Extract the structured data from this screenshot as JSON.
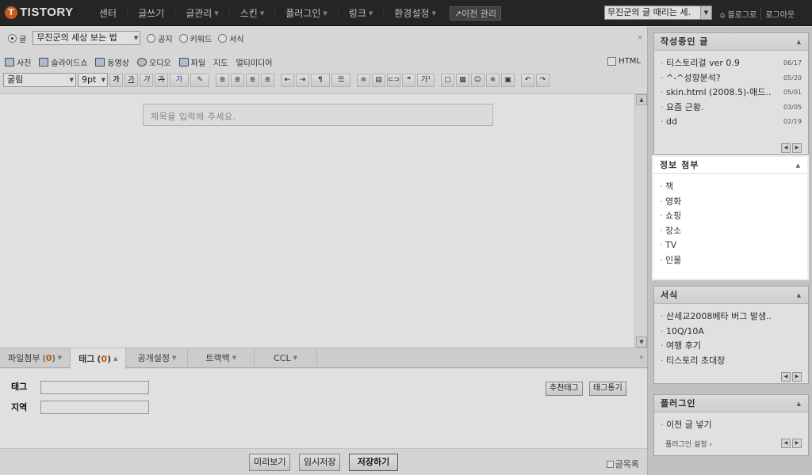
{
  "topbar": {
    "logo": "TISTORY",
    "nav": [
      {
        "label": "센터",
        "caret": false
      },
      {
        "label": "글쓰기",
        "caret": false
      },
      {
        "label": "글관리",
        "caret": true
      },
      {
        "label": "스킨",
        "caret": true
      },
      {
        "label": "플러그인",
        "caret": true
      },
      {
        "label": "링크",
        "caret": true
      },
      {
        "label": "환경설정",
        "caret": true
      }
    ],
    "prev_mgmt": "↗이전 관리",
    "blog_select": "무진군의 글 때리는 세.",
    "links": [
      "⌂ 블로그로",
      "로그아웃"
    ]
  },
  "post_type": {
    "selected": "글",
    "category": "무진군의 세상 보는 법",
    "options": [
      "공지",
      "키워드",
      "서식"
    ]
  },
  "media": [
    "사진",
    "슬라이드쇼",
    "동영상",
    "오디오",
    "파일",
    "지도",
    "멀티미디어"
  ],
  "html_label": "HTML",
  "format": {
    "font": "굴림",
    "size": "9pt",
    "buttons": [
      "가",
      "가",
      "가",
      "가",
      "가",
      "≣",
      "≣",
      "≣",
      "≣",
      "⇤",
      "⇥",
      "¶",
      "☰",
      "≡",
      "▤",
      "⊂⊃",
      "❝",
      "가¹",
      "□",
      "▦",
      "☺",
      "※",
      "▣",
      "↶",
      "↷"
    ]
  },
  "editor": {
    "title_placeholder": "제목을 입력해 주세요."
  },
  "tabs": [
    {
      "label": "파일첨부",
      "count": "0",
      "active": false
    },
    {
      "label": "태그",
      "count": "0",
      "active": true
    },
    {
      "label": "공개설정",
      "count": "",
      "active": false
    },
    {
      "label": "트랙백",
      "count": "",
      "active": false
    },
    {
      "label": "CCL",
      "count": "",
      "active": false
    }
  ],
  "tagpanel": {
    "tag_label": "태그",
    "location_label": "지역",
    "recommend_button": "추천태그",
    "view_button": "태그통기"
  },
  "bottom": {
    "preview": "미리보기",
    "temp_save": "임시저장",
    "save": "저장하기",
    "list": "글목록"
  },
  "sidebar": {
    "drafts": {
      "title": "작성중인 글",
      "items": [
        {
          "text": "티스토리걸 ver 0.9",
          "date": "06/17"
        },
        {
          "text": "^-^성향분석?",
          "date": "05/20"
        },
        {
          "text": "skin.html (2008.5)-애드..",
          "date": "05/01"
        },
        {
          "text": "요즘 근황.",
          "date": "03/05"
        },
        {
          "text": "dd",
          "date": "02/19"
        }
      ]
    },
    "info": {
      "title": "정보 첨부",
      "items": [
        "책",
        "영화",
        "쇼핑",
        "장소",
        "TV",
        "인물"
      ]
    },
    "templates": {
      "title": "서식",
      "items": [
        "산세교2008베타 버그 발생..",
        "10Q/10A",
        "여행 후기",
        "티스토리 초대장"
      ]
    },
    "plugins": {
      "title": "플러그인",
      "items": [
        "이전 글 넣기"
      ],
      "settings": "플러그인 설정 ›"
    }
  }
}
